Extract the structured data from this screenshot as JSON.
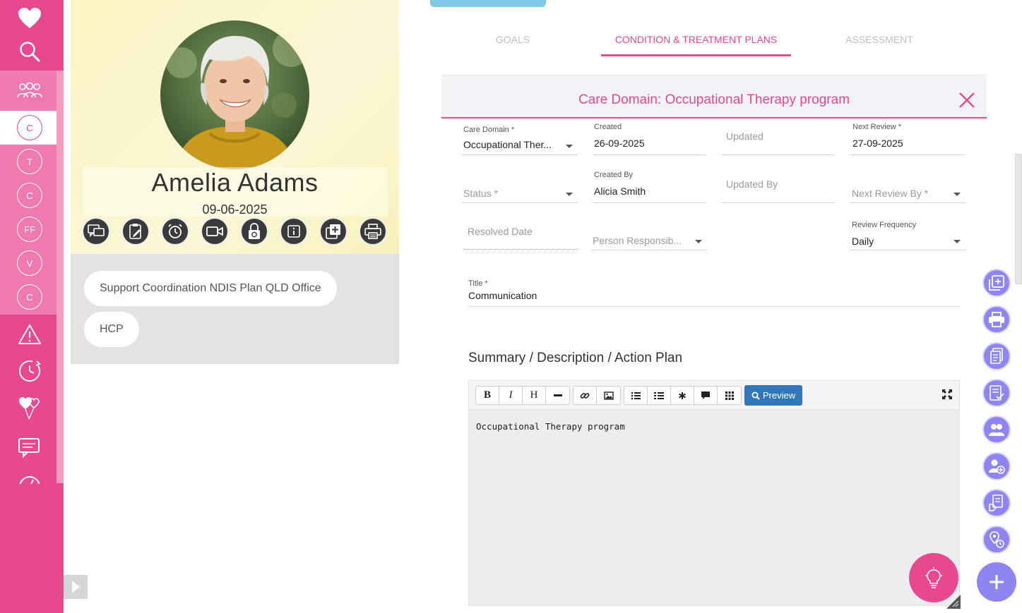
{
  "sidebar": {
    "circles": [
      "C",
      "T",
      "C",
      "FF",
      "V",
      "C"
    ]
  },
  "profile": {
    "name": "Amelia Adams",
    "date": "09-06-2025",
    "tags": [
      "Support Coordination NDIS Plan QLD Office",
      "HCP"
    ]
  },
  "tabs": [
    {
      "label": "GOALS"
    },
    {
      "label": "CONDITION & TREATMENT PLANS"
    },
    {
      "label": "ASSESSMENT"
    }
  ],
  "card": {
    "title": "Care Domain: Occupational Therapy program",
    "care_domain_label": "Care Domain *",
    "care_domain_value": "Occupational Ther...",
    "created_label": "Created",
    "created_value": "26-09-2025",
    "updated_placeholder": "Updated",
    "next_review_label": "Next Review *",
    "next_review_value": "27-09-2025",
    "status_placeholder": "Status *",
    "created_by_label": "Created By",
    "created_by_value": "Alicia Smith",
    "updated_by_placeholder": "Updated By",
    "next_review_by_placeholder": "Next Review By *",
    "resolved_date_placeholder": "Resolved Date",
    "person_responsible_placeholder": "Person Responsib...",
    "review_frequency_label": "Review Frequency",
    "review_frequency_value": "Daily",
    "title_label": "Title *",
    "title_value": "Communication",
    "section_title": "Summary / Description / Action Plan",
    "preview_label": "Preview",
    "editor_text": "Occupational Therapy program"
  },
  "colors": {
    "brand_pink": "#e8488f",
    "fab_purple": "#8d86f2",
    "preview_blue": "#2f77b8"
  }
}
